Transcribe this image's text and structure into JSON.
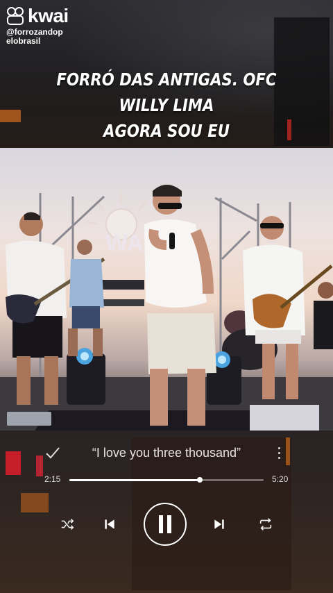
{
  "brand": {
    "name": "kwai",
    "handle_line1": "@forrozandop",
    "handle_line2": "elobrasil"
  },
  "overlay": {
    "line1": "FORRÓ DAS ANTIGAS. OFC",
    "line2": "WILLY LIMA",
    "line3": "AGORA SOU EU"
  },
  "player": {
    "song_title": "“I love you three thousand”",
    "current_time": "2:15",
    "total_time": "5:20",
    "progress": 0.67,
    "icons": [
      "check-icon",
      "more-icon",
      "shuffle-icon",
      "previous-icon",
      "pause-icon",
      "next-icon",
      "repeat-icon"
    ]
  }
}
